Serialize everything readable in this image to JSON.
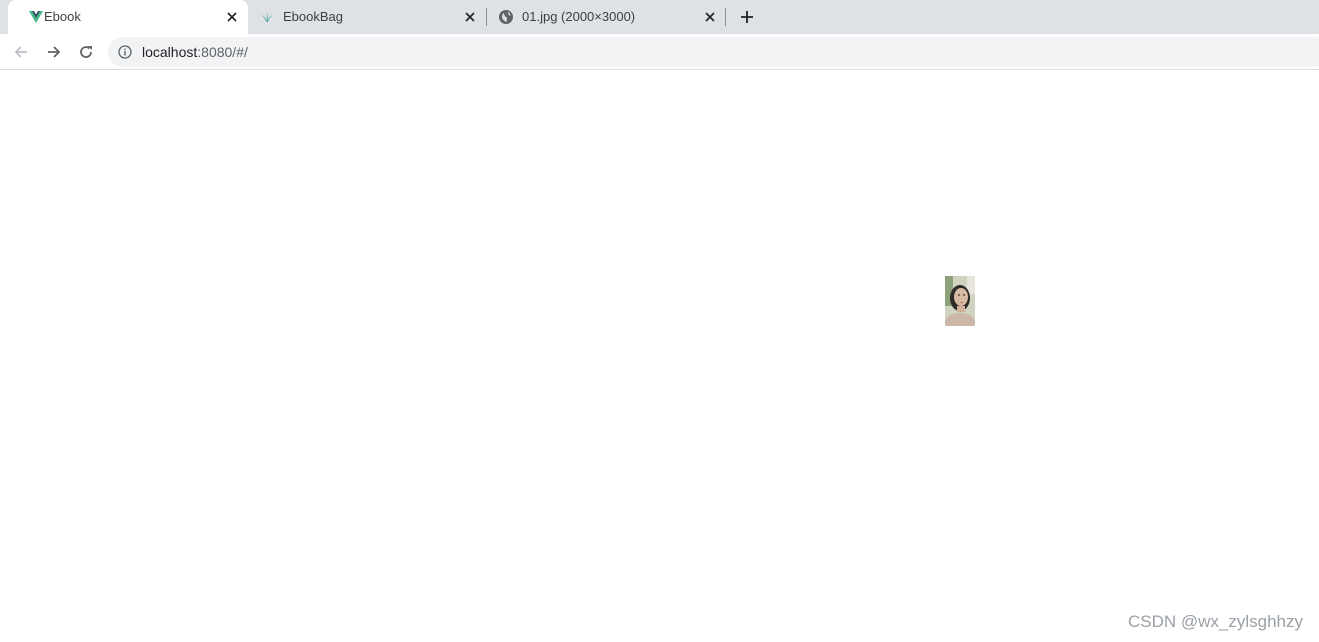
{
  "browser": {
    "tabs": [
      {
        "title": "Ebook",
        "active": true,
        "favicon": "vue-logo-icon"
      },
      {
        "title": "EbookBag",
        "active": false,
        "favicon": "plant-icon"
      },
      {
        "title": "01.jpg (2000×3000)",
        "active": false,
        "favicon": "globe-icon"
      }
    ],
    "url_host": "localhost",
    "url_rest": ":8080/#/"
  },
  "colors": {
    "tabstrip_bg": "#dee1e6",
    "omnibox_bg": "#f1f3f4",
    "vue_green": "#41b883",
    "vue_dark": "#34495e"
  },
  "page": {
    "image_alt": "small portrait photo thumbnail"
  },
  "watermark": "CSDN @wx_zylsghhzy"
}
